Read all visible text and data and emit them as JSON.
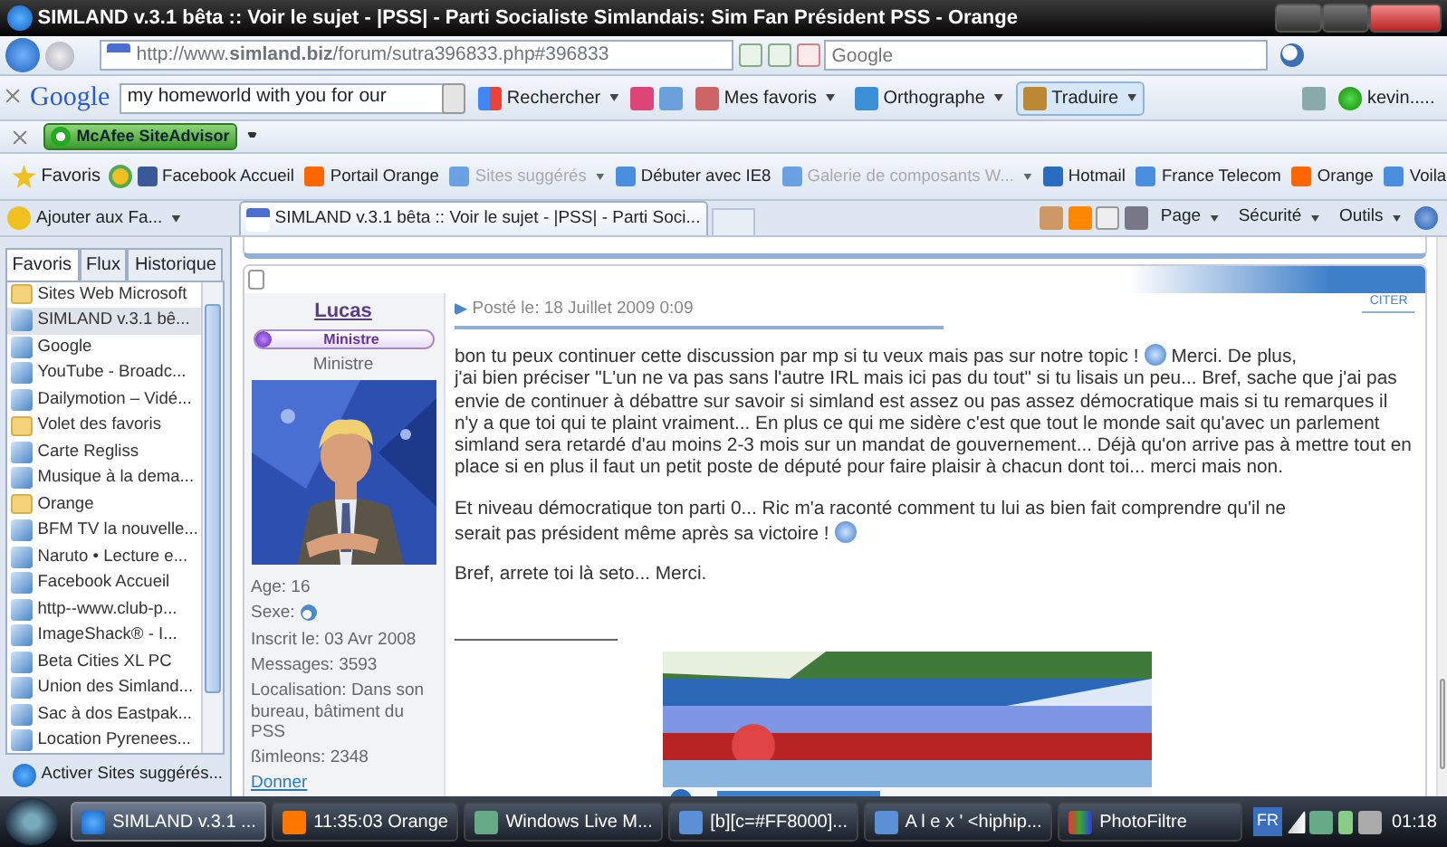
{
  "window": {
    "title": "SIMLAND v.3.1 bêta :: Voir le sujet - |PSS| - Parti Socialiste Simlandais: Sim Fan Président PSS - Orange"
  },
  "address_bar": {
    "url": "http://www.**simland.biz**/forum/sutra396833.php#396833",
    "search": {
      "placeholder": "Google"
    }
  },
  "google_toolbar": {
    "logo": "Google",
    "query": "my homeworld with you for our",
    "items": [
      {
        "label": "Rechercher",
        "selected": false
      },
      {
        "label": "Mes favoris",
        "selected": false
      },
      {
        "label": "Orthographe",
        "selected": false
      },
      {
        "label": "Traduire",
        "selected": true
      }
    ],
    "account": "kevin....."
  },
  "mcafee": {
    "label": "McAfee SiteAdvisor"
  },
  "favorites_bar": {
    "title": "Favoris",
    "items": [
      {
        "label": "Facebook  Accueil",
        "disabled": false
      },
      {
        "label": "Portail Orange",
        "disabled": false
      },
      {
        "label": "Sites suggérés",
        "disabled": true
      },
      {
        "label": "Débuter avec IE8",
        "disabled": false
      },
      {
        "label": "Galerie de composants W...",
        "disabled": true
      },
      {
        "label": "Hotmail",
        "disabled": false
      },
      {
        "label": "France Telecom",
        "disabled": false
      },
      {
        "label": "Orange",
        "disabled": false
      },
      {
        "label": "Voila",
        "disabled": false
      }
    ]
  },
  "tab": {
    "title": "SIMLAND v.3.1 bêta :: Voir le sujet - |PSS| - Parti Soci..."
  },
  "command_bar": [
    "Page",
    "Sécurité",
    "Outils"
  ],
  "sidebar": {
    "add_button": "Ajouter aux Fa...",
    "tabs": [
      {
        "label": "Favoris",
        "selected": true
      },
      {
        "label": "Flux",
        "selected": false
      },
      {
        "label": "Historique",
        "selected": false
      }
    ],
    "items": [
      {
        "label": "Sites Web Microsoft",
        "kind": "folder",
        "selected": false
      },
      {
        "label": "SIMLAND v.3.1 bê...",
        "kind": "link",
        "selected": true
      },
      {
        "label": "Google",
        "kind": "link",
        "selected": false
      },
      {
        "label": "YouTube - Broadc...",
        "kind": "link",
        "selected": false
      },
      {
        "label": "Dailymotion – Vidé...",
        "kind": "link",
        "selected": false
      },
      {
        "label": "Volet des favoris",
        "kind": "folder",
        "selected": false
      },
      {
        "label": "Carte Regliss",
        "kind": "link",
        "selected": false
      },
      {
        "label": "Musique à la dema...",
        "kind": "link",
        "selected": false
      },
      {
        "label": "Orange",
        "kind": "folder",
        "selected": false
      },
      {
        "label": "BFM TV la nouvelle...",
        "kind": "link",
        "selected": false
      },
      {
        "label": "Naruto • Lecture e...",
        "kind": "link",
        "selected": false
      },
      {
        "label": "Facebook  Accueil",
        "kind": "link",
        "selected": false
      },
      {
        "label": "http--www.club-p...",
        "kind": "link",
        "selected": false
      },
      {
        "label": "ImageShack® - I...",
        "kind": "link",
        "selected": false
      },
      {
        "label": "Beta Cities XL PC",
        "kind": "link",
        "selected": false
      },
      {
        "label": "Union des Simland...",
        "kind": "link",
        "selected": false
      },
      {
        "label": "Sac à dos Eastpak...",
        "kind": "link",
        "selected": false
      },
      {
        "label": "Location Pyrenees...",
        "kind": "link",
        "selected": false
      }
    ],
    "footer": "Activer Sites suggérés..."
  },
  "post": {
    "author": "Lucas",
    "rank_badge": "Ministre",
    "rank": "Ministre",
    "profile": [
      "Age: 16",
      "Sexe:",
      "Inscrit le: 03 Avr 2008",
      "Messages: 3593",
      "Localisation: Dans son bureau, bâtiment du PSS",
      "ßimleons: 2348"
    ],
    "give_link": "Donner",
    "date": "Posté le: 18 Juillet 2009 0:09",
    "quote": "CITER",
    "paragraphs": [
      [
        {
          "kind": "line",
          "text": "bon tu peux continuer cette discussion par mp si tu veux mais pas sur notre topic !"
        },
        {
          "kind": "smiley"
        },
        {
          "kind": "line",
          "text": "Merci. De plus,"
        },
        {
          "kind": "block",
          "text": "j'ai bien préciser \"L'un ne va pas sans l'autre IRL mais ici pas du tout\" si tu lisais un peu... Bref, sache que j'ai pas envie de continuer à débattre sur savoir si simland est assez ou pas assez démocratique mais si tu remarques il n'y a que toi qui te plaint vraiment... En plus ce qui me sidère c'est que tout le monde sait qu'avec un parlement simland sera retardé d'au moins 2-3 mois sur un mandat de gouvernement... Déjà qu'on arrive pas à mettre tout en place si en plus il faut un petit poste de député pour faire plaisir à chacun dont toi... merci mais non."
        }
      ],
      [
        {
          "kind": "block",
          "text": "Et niveau démocratique ton parti 0... Ric m'a raconté comment tu lui as bien fait comprendre qu'il ne"
        },
        {
          "kind": "line",
          "text": "serait pas président même après sa victoire !"
        },
        {
          "kind": "smiley"
        }
      ],
      [
        {
          "kind": "block",
          "text": "Bref, arrete toi là seto... Merci."
        }
      ]
    ]
  },
  "taskbar": {
    "items": [
      {
        "label": "SIMLAND v.3.1 ...",
        "selected": true
      },
      {
        "label": "11:35:03 Orange",
        "selected": false
      },
      {
        "label": "Windows Live M...",
        "selected": false
      },
      {
        "label": "[b][c=#FF8000]...",
        "selected": false
      },
      {
        "label": "A l e x ' <hiphip...",
        "selected": false
      },
      {
        "label": "PhotoFiltre",
        "selected": false
      }
    ],
    "language": "FR",
    "clock": "01:18"
  }
}
